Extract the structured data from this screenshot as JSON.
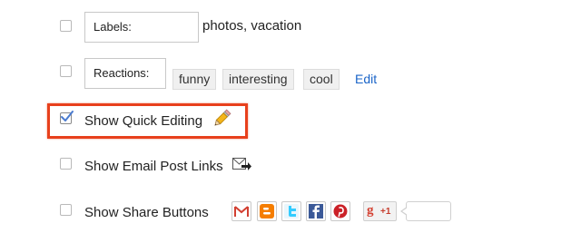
{
  "labels_row": {
    "button_label": "Labels:",
    "value_text": "photos, vacation"
  },
  "reactions_row": {
    "button_label": "Reactions:",
    "chips": [
      "funny",
      "interesting",
      "cool"
    ],
    "edit_link": "Edit"
  },
  "quick_editing": {
    "label": "Show Quick Editing",
    "checked": true,
    "icon": "pencil-icon"
  },
  "email_links": {
    "label": "Show Email Post Links",
    "checked": false,
    "icon": "email-forward-icon"
  },
  "share_buttons": {
    "label": "Show Share Buttons",
    "checked": false,
    "buttons": [
      "gmail-icon",
      "blogger-icon",
      "twitter-icon",
      "facebook-icon",
      "pinterest-icon"
    ],
    "gplus_label": "+1"
  },
  "colors": {
    "highlight": "#e8401c",
    "link": "#1a64c8"
  }
}
